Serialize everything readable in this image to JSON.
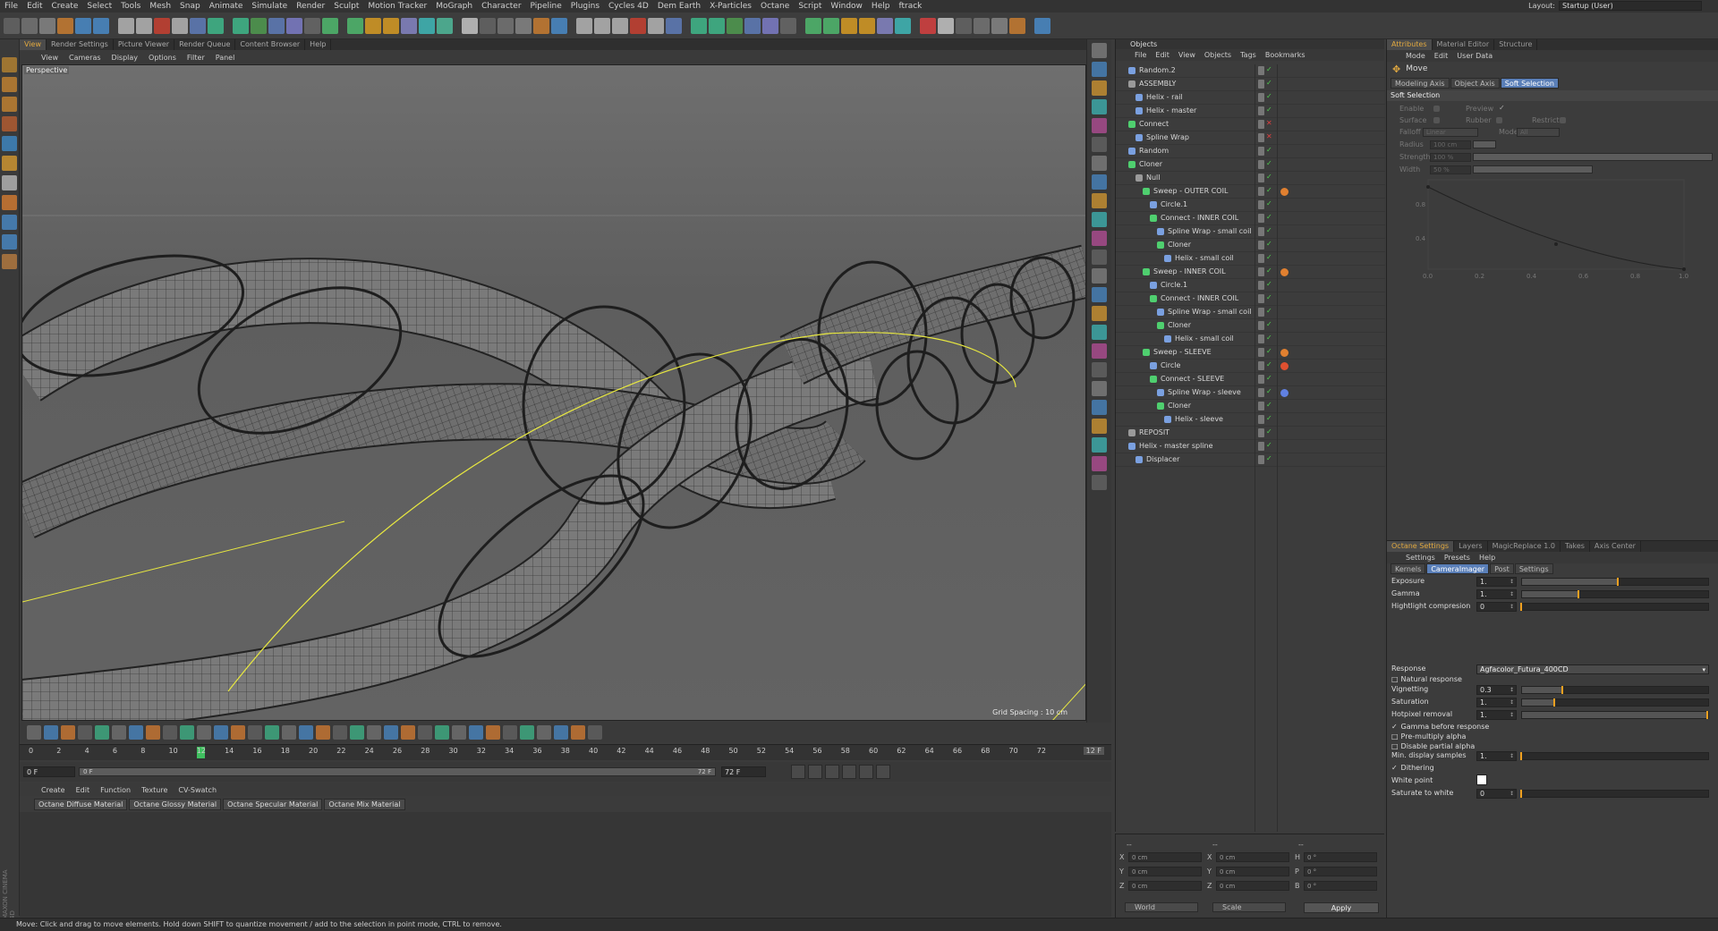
{
  "menu": [
    "File",
    "Edit",
    "Create",
    "Select",
    "Tools",
    "Mesh",
    "Snap",
    "Animate",
    "Simulate",
    "Render",
    "Sculpt",
    "Motion Tracker",
    "MoGraph",
    "Character",
    "Pipeline",
    "Plugins",
    "Cycles 4D",
    "Dem Earth",
    "X-Particles",
    "Octane",
    "Script",
    "Window",
    "Help",
    "ftrack"
  ],
  "layout": {
    "label": "Layout:",
    "value": "Startup (User)"
  },
  "viewport": {
    "tabs": [
      "View",
      "Render Settings",
      "Picture Viewer",
      "Render Queue",
      "Content Browser",
      "Help"
    ],
    "menu": [
      "View",
      "Cameras",
      "Display",
      "Options",
      "Filter",
      "Panel"
    ],
    "camera_label": "Perspective",
    "grid_spacing": "Grid Spacing : 10 cm"
  },
  "timeline": {
    "ticks": [
      "0",
      "2",
      "4",
      "6",
      "8",
      "10",
      "12",
      "14",
      "16",
      "18",
      "20",
      "22",
      "24",
      "26",
      "28",
      "30",
      "32",
      "34",
      "36",
      "38",
      "40",
      "42",
      "44",
      "46",
      "48",
      "50",
      "52",
      "54",
      "56",
      "58",
      "60",
      "62",
      "64",
      "66",
      "68",
      "70",
      "72"
    ],
    "end_label": "12 F",
    "start_frame": "0 F",
    "range_start": "0 F",
    "range_end": "72 F",
    "end_frame": "72 F"
  },
  "materials": {
    "menu": [
      "Create",
      "Edit",
      "Function",
      "Texture",
      "CV-Swatch"
    ],
    "items": [
      "Octane Diffuse Material",
      "Octane Glossy Material",
      "Octane Specular Material",
      "Octane Mix Material"
    ]
  },
  "maxon_logo": "MAXON CINEMA 4D",
  "status": "Move: Click and drag to move elements. Hold down SHIFT to quantize movement / add to the selection in point mode, CTRL to remove.",
  "objects": {
    "title": "Objects",
    "menu": [
      "File",
      "Edit",
      "View",
      "Objects",
      "Tags",
      "Bookmarks"
    ],
    "rows": [
      {
        "name": "Random.2",
        "depth": 0,
        "color": "#7aa0e0",
        "check": "ok"
      },
      {
        "name": "ASSEMBLY",
        "depth": 0,
        "color": "#9a9a9a",
        "check": "ok"
      },
      {
        "name": "Helix - rail",
        "depth": 1,
        "color": "#7aa0e0",
        "check": "ok"
      },
      {
        "name": "Helix - master",
        "depth": 1,
        "color": "#7aa0e0",
        "check": "ok"
      },
      {
        "name": "Connect",
        "depth": 0,
        "color": "#4fcf6f",
        "check": "x"
      },
      {
        "name": "Spline Wrap",
        "depth": 1,
        "color": "#7aa0e0",
        "check": "x"
      },
      {
        "name": "Random",
        "depth": 0,
        "color": "#7aa0e0",
        "check": "ok"
      },
      {
        "name": "Cloner",
        "depth": 0,
        "color": "#4fcf6f",
        "check": "ok"
      },
      {
        "name": "Null",
        "depth": 1,
        "color": "#9a9a9a",
        "check": "ok"
      },
      {
        "name": "Sweep - OUTER COIL",
        "depth": 2,
        "color": "#4fcf6f",
        "check": "ok",
        "tag": "#e08030"
      },
      {
        "name": "Circle.1",
        "depth": 3,
        "color": "#7aa0e0",
        "check": "ok"
      },
      {
        "name": "Connect - INNER COIL",
        "depth": 3,
        "color": "#4fcf6f",
        "check": "ok"
      },
      {
        "name": "Spline Wrap - small coil",
        "depth": 4,
        "color": "#7aa0e0",
        "check": "ok"
      },
      {
        "name": "Cloner",
        "depth": 4,
        "color": "#4fcf6f",
        "check": "ok"
      },
      {
        "name": "Helix - small coil",
        "depth": 5,
        "color": "#7aa0e0",
        "check": "ok"
      },
      {
        "name": "Sweep - INNER COIL",
        "depth": 2,
        "color": "#4fcf6f",
        "check": "ok",
        "tag": "#e08030"
      },
      {
        "name": "Circle.1",
        "depth": 3,
        "color": "#7aa0e0",
        "check": "ok"
      },
      {
        "name": "Connect - INNER COIL",
        "depth": 3,
        "color": "#4fcf6f",
        "check": "ok"
      },
      {
        "name": "Spline Wrap - small coil",
        "depth": 4,
        "color": "#7aa0e0",
        "check": "ok"
      },
      {
        "name": "Cloner",
        "depth": 4,
        "color": "#4fcf6f",
        "check": "ok"
      },
      {
        "name": "Helix - small coil",
        "depth": 5,
        "color": "#7aa0e0",
        "check": "ok"
      },
      {
        "name": "Sweep - SLEEVE",
        "depth": 2,
        "color": "#4fcf6f",
        "check": "ok",
        "tag": "#e08030"
      },
      {
        "name": "Circle",
        "depth": 3,
        "color": "#7aa0e0",
        "check": "ok",
        "tag": "#e05030"
      },
      {
        "name": "Connect - SLEEVE",
        "depth": 3,
        "color": "#4fcf6f",
        "check": "ok"
      },
      {
        "name": "Spline Wrap - sleeve",
        "depth": 4,
        "color": "#7aa0e0",
        "check": "ok",
        "tag": "#6080e0"
      },
      {
        "name": "Cloner",
        "depth": 4,
        "color": "#4fcf6f",
        "check": "ok"
      },
      {
        "name": "Helix - sleeve",
        "depth": 5,
        "color": "#7aa0e0",
        "check": "ok"
      },
      {
        "name": "REPOSIT",
        "depth": 0,
        "color": "#9a9a9a",
        "check": "ok"
      },
      {
        "name": "Helix - master spline",
        "depth": 0,
        "color": "#7aa0e0",
        "check": "ok"
      },
      {
        "name": "Displacer",
        "depth": 1,
        "color": "#7aa0e0",
        "check": "ok"
      }
    ]
  },
  "coordinates": {
    "header": [
      "--",
      "--",
      "--"
    ],
    "rows": [
      {
        "a": "X",
        "av": "0 cm",
        "b": "X",
        "bv": "0 cm",
        "c": "H",
        "cv": "0 °"
      },
      {
        "a": "Y",
        "av": "0 cm",
        "b": "Y",
        "bv": "0 cm",
        "c": "P",
        "cv": "0 °"
      },
      {
        "a": "Z",
        "av": "0 cm",
        "b": "Z",
        "bv": "0 cm",
        "c": "B",
        "cv": "0 °"
      }
    ],
    "mode1": "World",
    "mode2": "Scale",
    "apply": "Apply"
  },
  "attributes": {
    "tabs": [
      "Attributes",
      "Material Editor",
      "Structure"
    ],
    "menu": [
      "Mode",
      "Edit",
      "User Data"
    ],
    "tool": "Move",
    "subtabs": [
      "Modeling Axis",
      "Object Axis",
      "Soft Selection"
    ],
    "section": "Soft Selection",
    "props": {
      "enable": "Enable",
      "preview": "Preview",
      "preview_check": "✓",
      "surface": "Surface",
      "rubber": "Rubber",
      "restrict": "Restrict",
      "falloff": "Falloff",
      "falloff_value": "Linear",
      "mode": "Mode",
      "mode_value": "All",
      "radius": "Radius",
      "radius_value": "100 cm",
      "strength": "Strength",
      "strength_value": "100 %",
      "width": "Width",
      "width_value": "50 %"
    },
    "curve_x_ticks": [
      "0.0",
      "0.2",
      "0.4",
      "0.6",
      "0.8",
      "1.0"
    ],
    "curve_y_ticks": [
      "0.8",
      "0.4"
    ]
  },
  "octane": {
    "tabs": [
      "Octane Settings",
      "Layers",
      "MagicReplace 1.0",
      "Takes",
      "Axis Center"
    ],
    "menu": [
      "Settings",
      "Presets",
      "Help"
    ],
    "subtabs": [
      "Kernels",
      "CameraImager",
      "Post",
      "Settings"
    ],
    "exposure": {
      "label": "Exposure",
      "value": "1.",
      "level": 0.52
    },
    "gamma": {
      "label": "Gamma",
      "value": "1.",
      "level": 0.31
    },
    "highlight": {
      "label": "Hightlight compresion",
      "value": "0",
      "level": 0.0
    },
    "response": {
      "label": "Response",
      "value": "Agfacolor_Futura_400CD"
    },
    "natural_response": "Natural response",
    "vignetting": {
      "label": "Vignetting",
      "value": "0.3",
      "level": 0.22
    },
    "saturation": {
      "label": "Saturation",
      "value": "1.",
      "level": 0.18
    },
    "hotpixel": {
      "label": "Hotpixel removal",
      "value": "1.",
      "level": 1.0
    },
    "gamma_before": "Gamma before response",
    "premultiply": "Pre-multiply alpha",
    "disable_partial": "Disable partial alpha",
    "min_samples": {
      "label": "Min. display samples",
      "value": "1.",
      "level": 0.0
    },
    "dithering": "Dithering",
    "white_point": "White point",
    "white_point_color": "#ffffff",
    "saturate_white": {
      "label": "Saturate to white",
      "value": "0",
      "level": 0.0
    },
    "check_mark": "✓"
  }
}
